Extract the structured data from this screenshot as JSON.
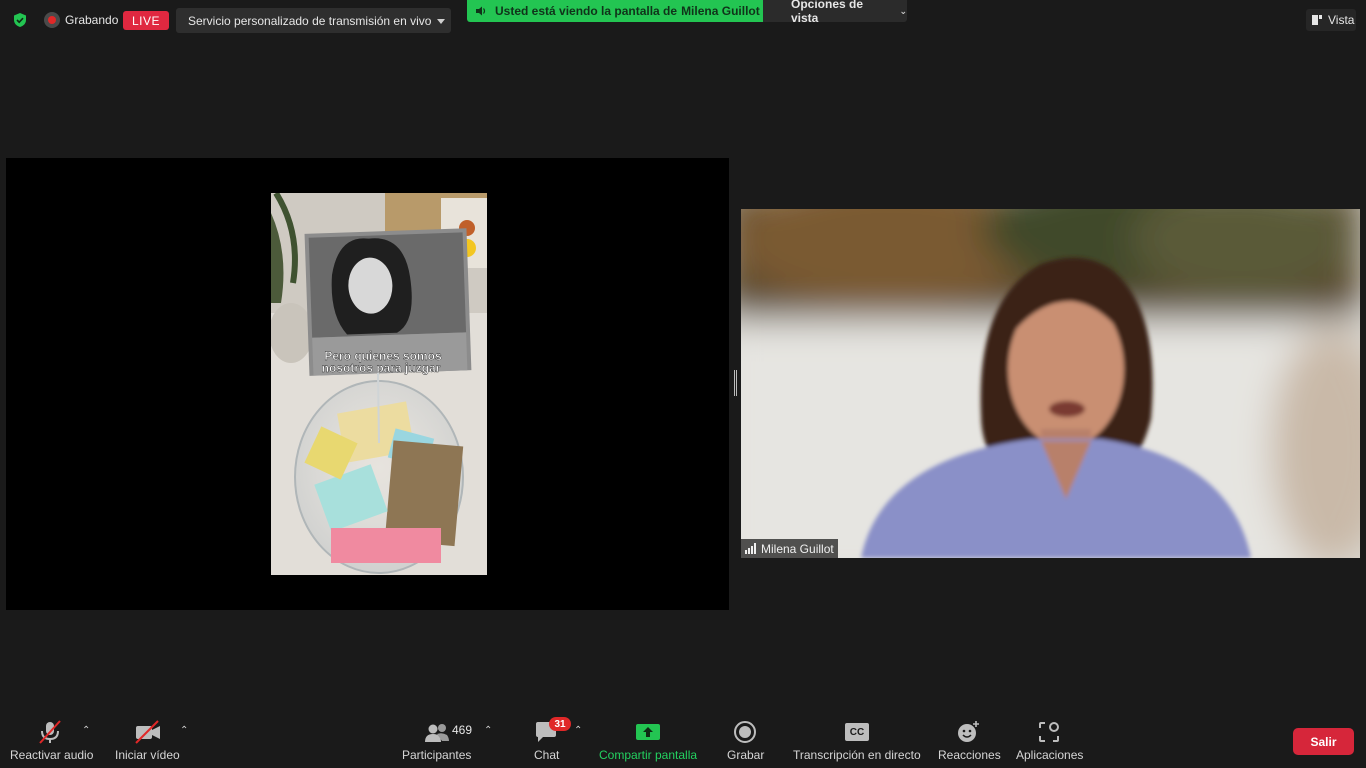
{
  "topbar": {
    "recording_label": "Grabando",
    "live_badge": "LIVE",
    "stream_service": "Servicio personalizado de transmisión en vivo",
    "share_banner_prefix": "Usted está viendo la pantalla de",
    "share_banner_name": "Milena Guillot",
    "view_options_label": "Opciones de vista",
    "vista_label": "Vista"
  },
  "shared_screen": {
    "caption_line1": "Pero quienes somos",
    "caption_line2": "nosotros para juzgar"
  },
  "participant": {
    "name": "Milena Guillot"
  },
  "toolbar": {
    "audio_label": "Reactivar audio",
    "video_label": "Iniciar vídeo",
    "participants_label": "Participantes",
    "participants_count": "469",
    "chat_label": "Chat",
    "chat_badge": "31",
    "share_label": "Compartir pantalla",
    "record_label": "Grabar",
    "cc_icon_text": "CC",
    "transcription_label": "Transcripción en directo",
    "reactions_label": "Reacciones",
    "apps_label": "Aplicaciones",
    "leave_label": "Salir"
  },
  "colors": {
    "share_green": "#23c552",
    "live_red": "#e02840",
    "leave_red": "#d6263a",
    "background": "#1a1a1a"
  }
}
